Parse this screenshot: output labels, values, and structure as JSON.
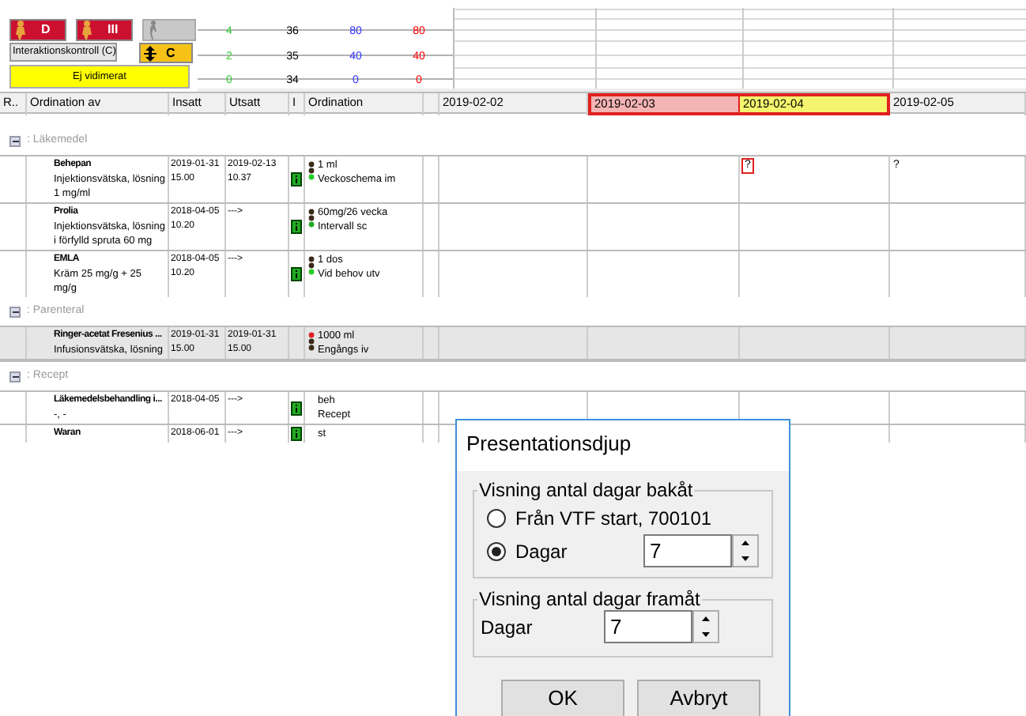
{
  "alerts": {
    "d_label": "D",
    "iii_label": "III",
    "interaction_button": "Interaktionskontroll (C)",
    "c_label": "C",
    "unverified": "Ej vidimerat"
  },
  "scales": [
    {
      "color": "#33cc33",
      "ticks": [
        "4",
        "2",
        "0"
      ]
    },
    {
      "color": "#000000",
      "ticks": [
        "36",
        "35",
        "34"
      ]
    },
    {
      "color": "#3333ff",
      "ticks": [
        "80",
        "40",
        "0"
      ]
    },
    {
      "color": "#ff0000",
      "ticks": [
        "80",
        "40",
        "0"
      ]
    }
  ],
  "columns": [
    "R..",
    "Ordination av",
    "Insatt",
    "Utsatt",
    "I",
    "Ordination"
  ],
  "dates": [
    {
      "label": "2019-02-02",
      "marked": false
    },
    {
      "label": "2019-02-03",
      "marked": true,
      "color": "#f4b4b4"
    },
    {
      "label": "2019-02-04",
      "marked": true,
      "color": "#f4f46e"
    },
    {
      "label": "2019-02-05",
      "marked": false
    }
  ],
  "groups": [
    {
      "name": ": Läkemedel",
      "expanded": true,
      "rows": [
        {
          "name": "Behepan",
          "form": "Injektionsvätska, lösning 1 mg/ml",
          "insatt": [
            "2019-01-31",
            "15.00"
          ],
          "utsatt": [
            "2019-02-13",
            "10.37"
          ],
          "info": true,
          "color": "#22cc22",
          "dose": "1 ml",
          "instruction": "Veckoschema im",
          "selected": false,
          "day_notes": [
            {
              "kind": "empty"
            },
            {
              "kind": "empty"
            },
            {
              "kind": "note",
              "text": "?",
              "flagged": true
            },
            {
              "kind": "note",
              "text": "?",
              "flagged": false
            }
          ]
        },
        {
          "name": "Prolia",
          "form": "Injektionsvätska, lösning i förfylld spruta 60 mg",
          "insatt": [
            "2018-04-05",
            "10.20"
          ],
          "utsatt": [
            "--->"
          ],
          "info": true,
          "color": "#22aa22",
          "dose": "60mg/26 vecka",
          "instruction": "Intervall sc",
          "selected": false
        },
        {
          "name": "EMLA",
          "form": "Kräm 25 mg/g + 25 mg/g",
          "insatt": [
            "2018-04-05",
            "10.20"
          ],
          "utsatt": [
            "--->"
          ],
          "info": true,
          "color": "#22cc22",
          "dose": "1 dos",
          "instruction": "Vid behov utv",
          "selected": false
        }
      ]
    },
    {
      "name": ": Parenteral",
      "expanded": true,
      "rows": [
        {
          "name": "Ringer-acetat Fresenius ...",
          "form": "Infusionsvätska, lösning",
          "insatt": [
            "2019-01-31",
            "15.00"
          ],
          "utsatt": [
            "2019-01-31",
            "15.00"
          ],
          "info": false,
          "color": "#dd2222",
          "dose": "1000 ml",
          "instruction": "Engångs iv",
          "selected": true
        }
      ]
    },
    {
      "name": ": Recept",
      "expanded": true,
      "rows": [
        {
          "name": "Läkemedelsbehandling i...",
          "form": "-, -",
          "insatt": [
            "2018-04-05"
          ],
          "utsatt": [
            "--->"
          ],
          "info": true,
          "dose": "beh",
          "instruction": "Recept",
          "selected": false
        },
        {
          "name": "Waran",
          "insatt": [
            "2018-06-01"
          ],
          "utsatt": [
            "--->"
          ],
          "info": true,
          "dose": "st",
          "selected": false
        }
      ]
    }
  ],
  "dialog": {
    "title": "Presentationsdjup",
    "back_group": "Visning antal dagar bakåt",
    "back_options": [
      {
        "label": "Från VTF start, 700101",
        "selected": false
      },
      {
        "label": "Dagar",
        "selected": true
      }
    ],
    "back_value": "7",
    "forward_group": "Visning antal dagar framåt",
    "forward_label": "Dagar",
    "forward_value": "7",
    "buttons": [
      "OK",
      "Avbryt"
    ]
  }
}
